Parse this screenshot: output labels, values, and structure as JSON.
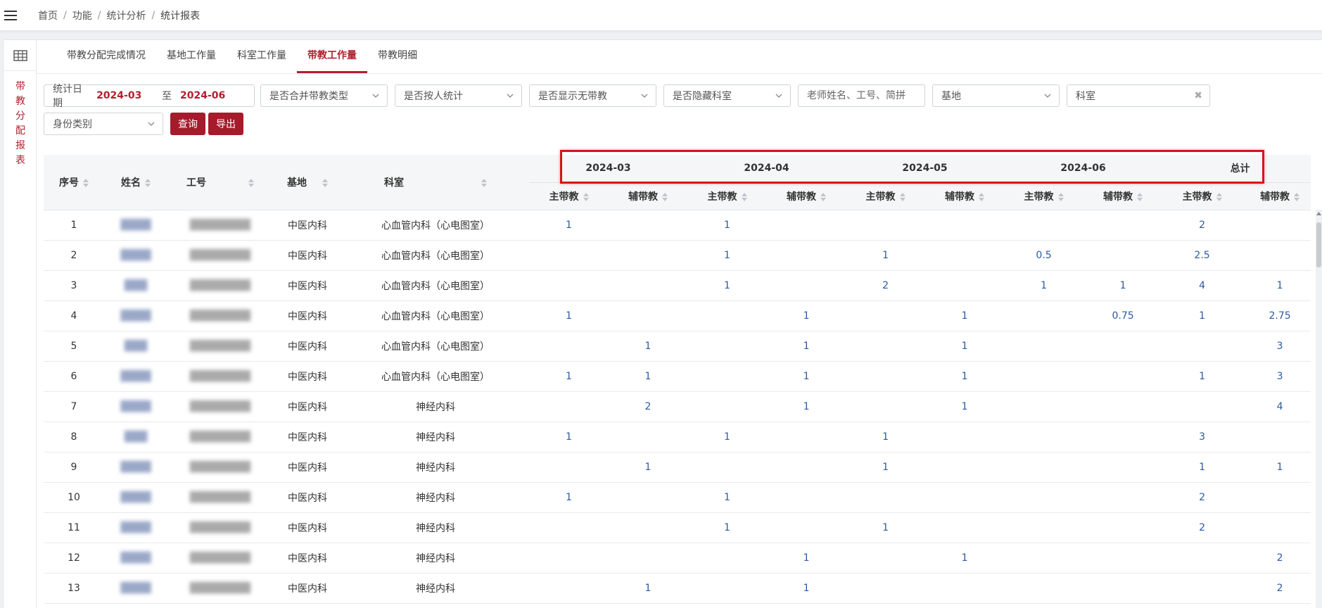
{
  "breadcrumb": [
    "首页",
    "功能",
    "统计分析",
    "统计报表"
  ],
  "side_title": [
    "带",
    "教",
    "分",
    "配",
    "报",
    "表"
  ],
  "tabs": [
    "带教分配完成情况",
    "基地工作量",
    "科室工作量",
    "带教工作量",
    "带教明细"
  ],
  "active_tab": 3,
  "filters": {
    "date_label": "统计日期",
    "date_start": "2024-03",
    "date_to": "至",
    "date_end": "2024-06",
    "merge_type": "是否合并带教类型",
    "by_person": "是否按人统计",
    "show_none": "是否显示无带教",
    "hide_dept": "是否隐藏科室",
    "teacher_placeholder": "老师姓名、工号、简拼",
    "base": "基地",
    "dept": "科室",
    "identity": "身份类别",
    "query_btn": "查询",
    "export_btn": "导出"
  },
  "table": {
    "fixed_headers": [
      "序号",
      "姓名",
      "工号",
      "基地",
      "科室"
    ],
    "months": [
      "2024-03",
      "2024-04",
      "2024-05",
      "2024-06",
      "总计"
    ],
    "sub_headers": [
      "主带教",
      "辅带教"
    ],
    "rows": [
      {
        "no": "1",
        "name": "████",
        "id": "████████",
        "base": "中医内科",
        "dept": "心血管内科（心电图室）",
        "v": [
          "1",
          "",
          "1",
          "",
          "",
          "",
          "",
          "",
          "2",
          ""
        ]
      },
      {
        "no": "2",
        "name": "████",
        "id": "████████",
        "base": "中医内科",
        "dept": "心血管内科（心电图室）",
        "v": [
          "",
          "",
          "1",
          "",
          "1",
          "",
          "0.5",
          "",
          "2.5",
          ""
        ]
      },
      {
        "no": "3",
        "name": "███",
        "id": "████████",
        "base": "中医内科",
        "dept": "心血管内科（心电图室）",
        "v": [
          "",
          "",
          "1",
          "",
          "2",
          "",
          "1",
          "1",
          "4",
          "1"
        ]
      },
      {
        "no": "4",
        "name": "████",
        "id": "████████",
        "base": "中医内科",
        "dept": "心血管内科（心电图室）",
        "v": [
          "1",
          "",
          "",
          "1",
          "",
          "1",
          "",
          "0.75",
          "1",
          "2.75"
        ]
      },
      {
        "no": "5",
        "name": "███",
        "id": "████████",
        "base": "中医内科",
        "dept": "心血管内科（心电图室）",
        "v": [
          "",
          "1",
          "",
          "1",
          "",
          "1",
          "",
          "",
          "",
          "3"
        ]
      },
      {
        "no": "6",
        "name": "████",
        "id": "████████",
        "base": "中医内科",
        "dept": "心血管内科（心电图室）",
        "v": [
          "1",
          "1",
          "",
          "1",
          "",
          "1",
          "",
          "",
          "1",
          "3"
        ]
      },
      {
        "no": "7",
        "name": "████",
        "id": "████████",
        "base": "中医内科",
        "dept": "神经内科",
        "v": [
          "",
          "2",
          "",
          "1",
          "",
          "1",
          "",
          "",
          "",
          "4"
        ]
      },
      {
        "no": "8",
        "name": "███",
        "id": "████████",
        "base": "中医内科",
        "dept": "神经内科",
        "v": [
          "1",
          "",
          "1",
          "",
          "1",
          "",
          "",
          "",
          "3",
          ""
        ]
      },
      {
        "no": "9",
        "name": "████",
        "id": "████████",
        "base": "中医内科",
        "dept": "神经内科",
        "v": [
          "",
          "1",
          "",
          "",
          "1",
          "",
          "",
          "",
          "1",
          "1"
        ]
      },
      {
        "no": "10",
        "name": "████",
        "id": "████████",
        "base": "中医内科",
        "dept": "神经内科",
        "v": [
          "1",
          "",
          "1",
          "",
          "",
          "",
          "",
          "",
          "2",
          ""
        ]
      },
      {
        "no": "11",
        "name": "████",
        "id": "████████",
        "base": "中医内科",
        "dept": "神经内科",
        "v": [
          "",
          "",
          "1",
          "",
          "1",
          "",
          "",
          "",
          "2",
          ""
        ]
      },
      {
        "no": "12",
        "name": "████",
        "id": "████████",
        "base": "中医内科",
        "dept": "神经内科",
        "v": [
          "",
          "",
          "",
          "1",
          "",
          "1",
          "",
          "",
          "",
          "2"
        ]
      },
      {
        "no": "13",
        "name": "████",
        "id": "████████",
        "base": "中医内科",
        "dept": "神经内科",
        "v": [
          "",
          "1",
          "",
          "1",
          "",
          "",
          "",
          "",
          "",
          "2"
        ]
      }
    ]
  },
  "colors": {
    "accent": "#b22030",
    "button": "#a61b2c",
    "value": "#2c5aa0",
    "highlight": "#d8121d"
  }
}
